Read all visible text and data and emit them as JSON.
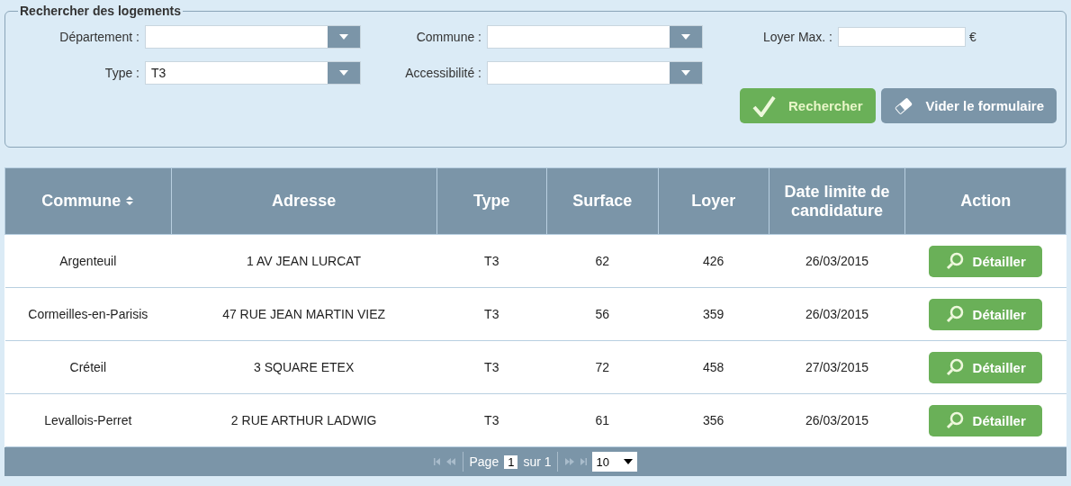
{
  "search": {
    "legend": "Rechercher des logements",
    "fields": [
      {
        "kind": "select",
        "label": "Département :"
      },
      {
        "kind": "select",
        "label": "Commune :"
      },
      {
        "kind": "text",
        "label": "Loyer Max. :",
        "suffix": "€"
      },
      {
        "kind": "select",
        "label": "Type :",
        "value": "T3"
      },
      {
        "kind": "select",
        "label": "Accessibilité :"
      }
    ],
    "buttons": [
      {
        "kind": "search",
        "label": "Rechercher"
      },
      {
        "kind": "clear",
        "label": "Vider le formulaire"
      }
    ]
  },
  "table": {
    "columns": [
      {
        "label": "Commune",
        "sortable": true
      },
      {
        "label": "Adresse",
        "sortable": false
      },
      {
        "label": "Type",
        "sortable": false
      },
      {
        "label": "Surface",
        "sortable": false
      },
      {
        "label": "Loyer",
        "sortable": false
      },
      {
        "label": "Date limite de candidature",
        "sortable": false
      },
      {
        "label": "Action",
        "sortable": false
      }
    ],
    "rows": [
      {
        "cells": [
          "Argenteuil",
          "1  AV  JEAN LURCAT",
          "T3",
          "62",
          "426",
          "26/03/2015"
        ],
        "action": "Détailler"
      },
      {
        "cells": [
          "Cormeilles-en-Parisis",
          "47 RUE JEAN MARTIN VIEZ",
          "T3",
          "56",
          "359",
          "26/03/2015"
        ],
        "action": "Détailler"
      },
      {
        "cells": [
          "Créteil",
          "3 SQUARE ETEX",
          "T3",
          "72",
          "458",
          "27/03/2015"
        ],
        "action": "Détailler"
      },
      {
        "cells": [
          "Levallois-Perret",
          "2 RUE ARTHUR LADWIG",
          "T3",
          "61",
          "356",
          "26/03/2015"
        ],
        "action": "Détailler"
      }
    ]
  },
  "pager": {
    "page_label": "Page",
    "page": "1",
    "of_label": "sur 1",
    "page_size": "10",
    "first_disabled": true,
    "last_disabled": true
  }
}
